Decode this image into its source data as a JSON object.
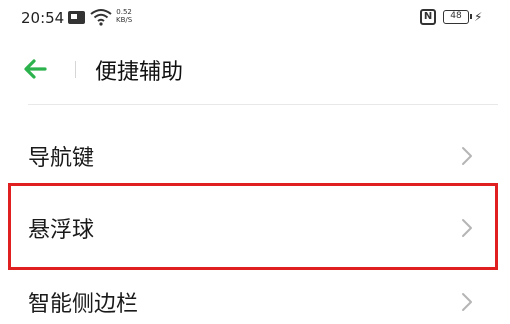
{
  "status_bar": {
    "time": "20:54",
    "net_speed_value": "0.52",
    "net_speed_unit": "KB/S",
    "nfc_label": "N",
    "battery_level": "48"
  },
  "header": {
    "title": "便捷辅助"
  },
  "menu": {
    "items": [
      {
        "label": "导航键"
      },
      {
        "label": "悬浮球"
      },
      {
        "label": "智能侧边栏"
      }
    ]
  },
  "colors": {
    "back_arrow": "#2bb24c",
    "highlight": "#e02020",
    "chevron": "#b5b5b5"
  }
}
